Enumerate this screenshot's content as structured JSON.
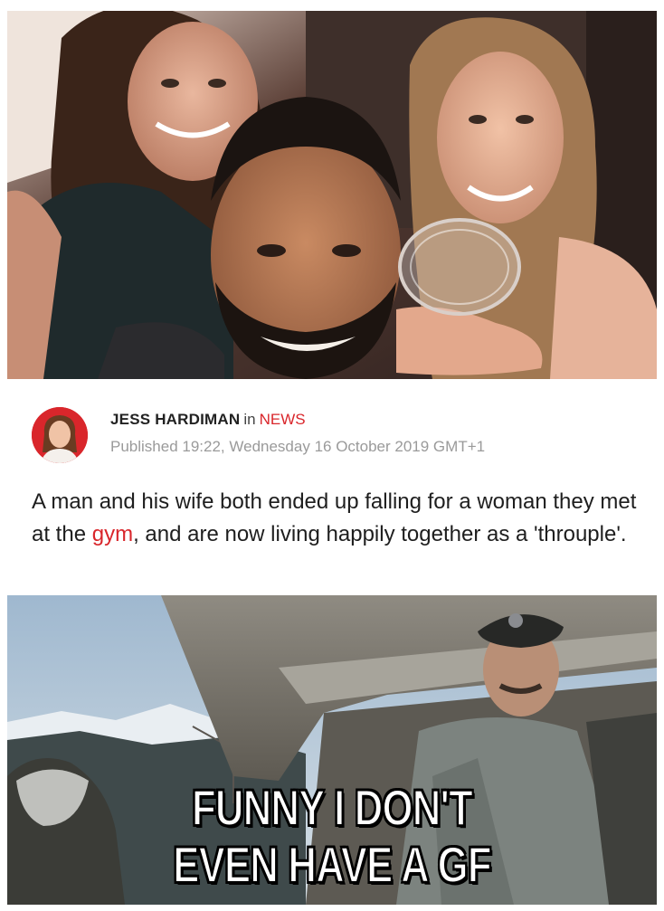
{
  "article": {
    "author": "JESS HARDIMAN",
    "in_word": "in",
    "section": "NEWS",
    "published": "Published 19:22, Wednesday 16 October 2019 GMT+1",
    "standfirst_before": "A man and his wife both ended up falling for a woman they met at the ",
    "standfirst_link": "gym",
    "standfirst_after": ", and are now living happily together as a 'throuple'."
  },
  "meme": {
    "caption_line1": "FUNNY I DON'T",
    "caption_line2": "EVEN HAVE A GF"
  },
  "colors": {
    "accent_red": "#d9262b",
    "meta_grey": "#9a9a9a",
    "body_text": "#1e1e1e"
  }
}
